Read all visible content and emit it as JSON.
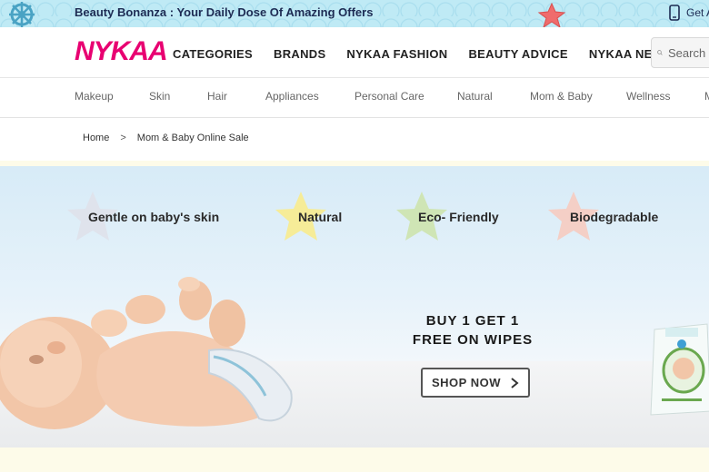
{
  "promo": {
    "text": "Beauty Bonanza : Your Daily Dose Of Amazing Offers",
    "app_text": "Get A"
  },
  "header": {
    "logo": "NYKAA",
    "nav": [
      "CATEGORIES",
      "BRANDS",
      "NYKAA FASHION",
      "BEAUTY ADVICE",
      "NYKAA NETWORK"
    ],
    "search_placeholder": "Search"
  },
  "subnav": {
    "items": [
      "Makeup",
      "Skin",
      "Hair",
      "Appliances",
      "Personal Care",
      "Natural",
      "Mom & Baby",
      "Wellness",
      "M"
    ]
  },
  "breadcrumb": {
    "home": "Home",
    "separator": ">",
    "current": "Mom & Baby Online Sale"
  },
  "banner": {
    "features": [
      {
        "label": "Gentle on baby's skin",
        "star_color": "#dfe3ec"
      },
      {
        "label": "Natural",
        "star_color": "#f6ec98"
      },
      {
        "label": "Eco- Friendly",
        "star_color": "#cfe5b5"
      },
      {
        "label": "Biodegradable",
        "star_color": "#f4cfc6"
      }
    ],
    "offer_line1": "BUY 1 GET 1",
    "offer_line2": "FREE ON WIPES",
    "cta": "SHOP NOW",
    "cta_icon": "chevron-right-icon"
  },
  "colors": {
    "brand": "#e80071",
    "promo_bg": "#bfeaf5",
    "banner_sky": "#d7ebf7",
    "page_cream": "#fdfbe9"
  }
}
